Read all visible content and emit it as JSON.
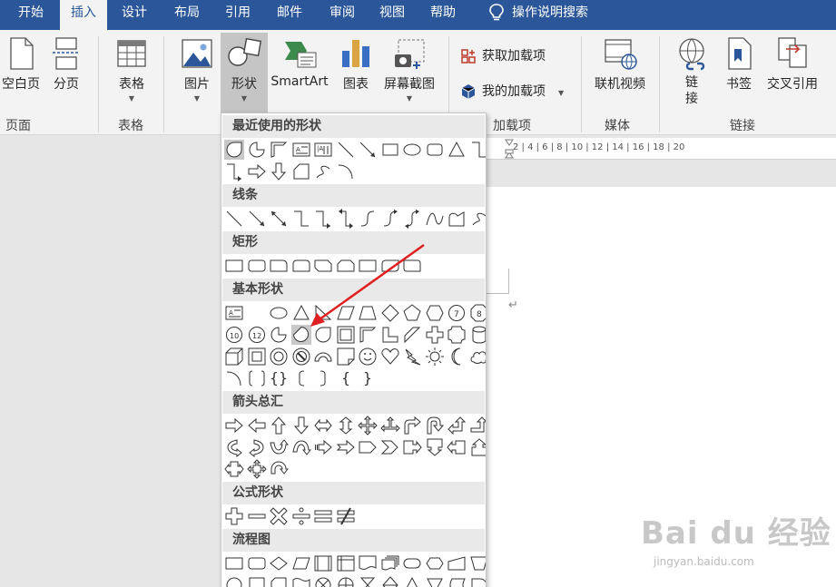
{
  "tabs": [
    "开始",
    "插入",
    "设计",
    "布局",
    "引用",
    "邮件",
    "审阅",
    "视图",
    "帮助"
  ],
  "active_tab": "插入",
  "tell_me": "操作说明搜索",
  "ribbon": {
    "blank_page": "空白页",
    "page_break": "分页",
    "table": "表格",
    "picture": "图片",
    "shapes": "形状",
    "smartart": "SmartArt",
    "chart": "图表",
    "screenshot": "屏幕截图",
    "get_addins": "获取加载项",
    "my_addins": "我的加载项",
    "online_video": "联机视频",
    "link": "链\n接",
    "bookmark": "书签",
    "cross_ref": "交叉引用"
  },
  "groups": {
    "pages": "页面",
    "tables": "表格",
    "addins": "加载项",
    "media": "媒体",
    "links": "链接"
  },
  "shapes_menu": {
    "recent": "最近使用的形状",
    "lines": "线条",
    "rectangles": "矩形",
    "basic": "基本形状",
    "arrows": "箭头总汇",
    "equation": "公式形状",
    "flowchart": "流程图"
  },
  "ruler": "2 | 4 | 6 | 8 | 10 | 12 | 14 | 16 | 18 | 20",
  "watermark": {
    "brand": "Bai du 经验",
    "url": "jingyan.baidu.com"
  },
  "colors": {
    "tab_bar": "#2b579a",
    "ribbon": "#f3f3f3",
    "arrow": "#e02020"
  }
}
